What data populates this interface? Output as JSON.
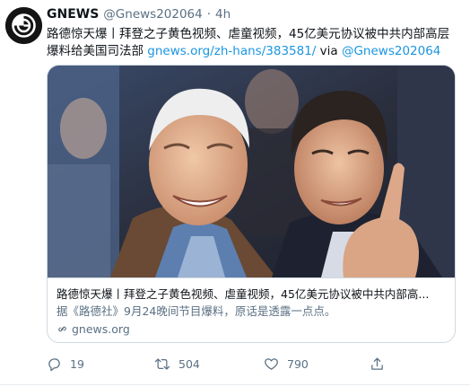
{
  "tweet": {
    "display_name": "GNEWS",
    "handle": "@Gnews202064",
    "separator": "·",
    "time": "4h",
    "text_line1": "路德惊天爆丨拜登之子黄色视频、虐童视频，45亿美元协议被中共内部高层",
    "text_line2_plain": "爆料给美国司法部 ",
    "link_url": "gnews.org/zh-hans/383581/",
    "via_word": " via ",
    "via_handle": "@Gnews202064"
  },
  "card": {
    "title": "路德惊天爆丨拜登之子黄色视频、虐童视频，45亿美元协议被中共内部高...",
    "description": "据《路德社》9月24晚间节目爆料，原话是透露一点点。",
    "domain": "gnews.org",
    "domain_icon": "link-icon"
  },
  "actions": {
    "reply_count": "19",
    "retweet_count": "504",
    "like_count": "790",
    "reply_icon": "reply-icon",
    "retweet_icon": "retweet-icon",
    "like_icon": "heart-icon",
    "share_icon": "share-icon"
  },
  "colors": {
    "link": "#1b95e0",
    "muted": "#5b7083",
    "text": "#0f1419",
    "border": "#cfd9de"
  }
}
